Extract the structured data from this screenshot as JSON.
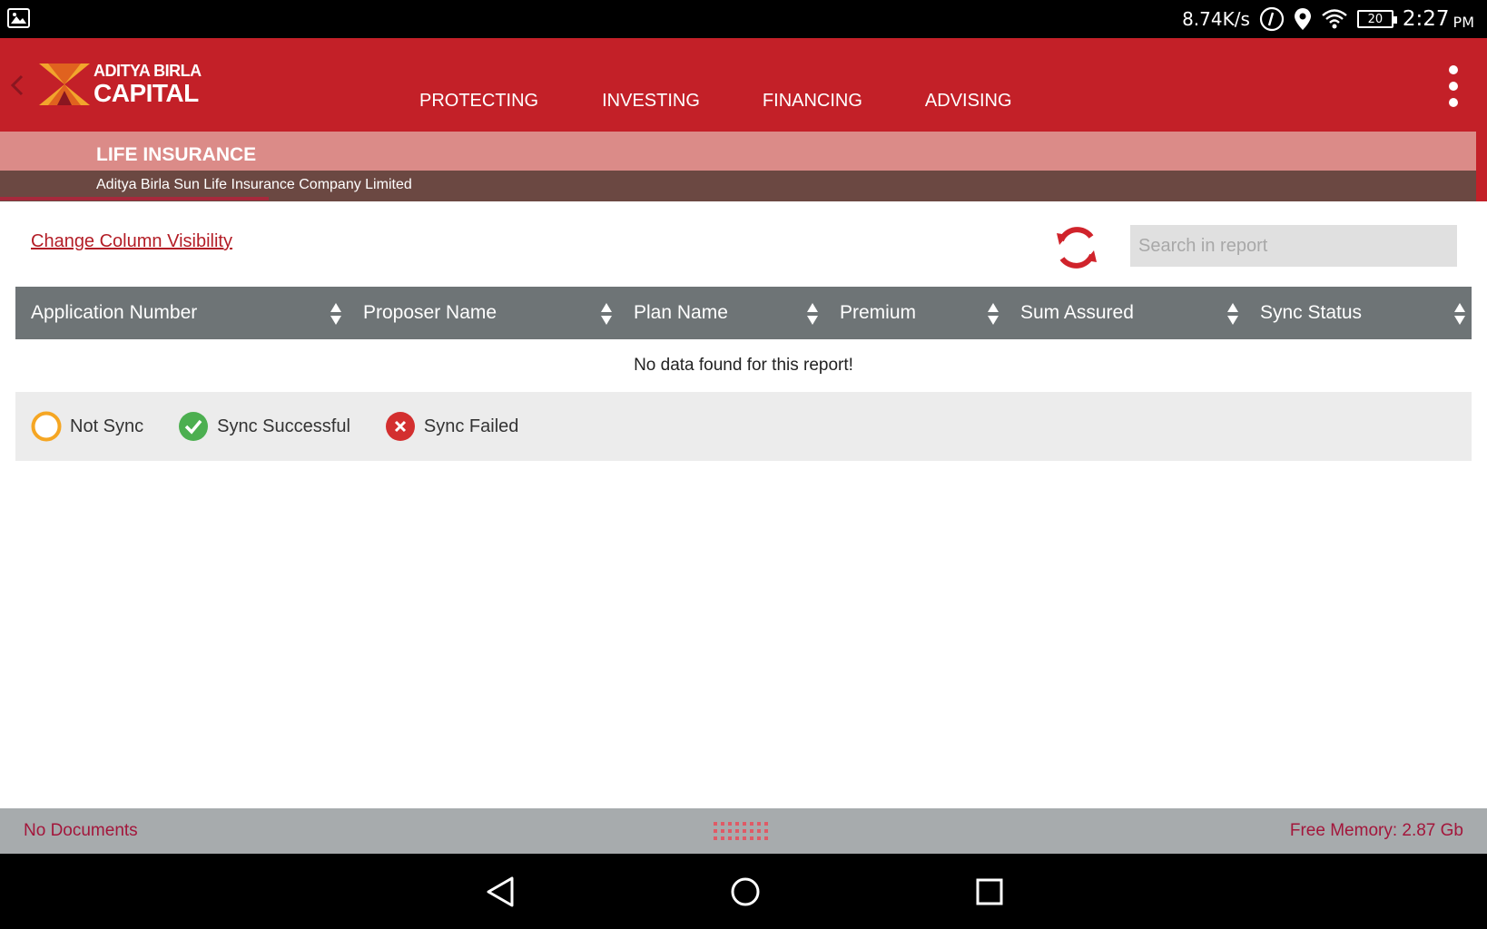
{
  "status_bar": {
    "net_speed": "8.74K/s",
    "battery": "20",
    "time": "2:27",
    "ampm": "PM",
    "icons": [
      "photo-icon",
      "data-saver-icon",
      "location-icon",
      "wifi-icon",
      "battery-icon"
    ]
  },
  "header": {
    "logo_line1": "ADITYA BIRLA",
    "logo_line2": "CAPITAL",
    "nav": [
      "PROTECTING",
      "INVESTING",
      "FINANCING",
      "ADVISING"
    ],
    "back_icon": "chevron-left-icon",
    "menu_icon": "kebab-menu-icon",
    "colors": {
      "brand_red": "#c32028",
      "banner_pink": "#db8b88",
      "banner_brown": "#6b4842"
    }
  },
  "banner": {
    "title": "LIFE INSURANCE",
    "subtitle": "Aditya Birla Sun Life Insurance Company Limited"
  },
  "toolbar": {
    "column_visibility_link": "Change Column Visibility",
    "search_placeholder": "Search in report",
    "search_value": "",
    "refresh_icon": "refresh-icon"
  },
  "table": {
    "columns": [
      "Application Number",
      "Proposer Name",
      "Plan Name",
      "Premium",
      "Sum Assured",
      "Sync Status"
    ],
    "empty_message": "No data found for this report!"
  },
  "legend": {
    "items": [
      {
        "label": "Not Sync",
        "icon": "empty-circle-icon",
        "color": "#f5a623"
      },
      {
        "label": "Sync Successful",
        "icon": "check-circle-icon",
        "color": "#4caf50"
      },
      {
        "label": "Sync Failed",
        "icon": "x-circle-icon",
        "color": "#d32f2f"
      }
    ]
  },
  "footer": {
    "left_text": "No Documents",
    "right_text": "Free Memory: 2.87 Gb",
    "grip_icon": "drag-handle-icon"
  },
  "android_nav": {
    "icons": [
      "back-triangle-icon",
      "home-circle-icon",
      "recents-square-icon"
    ]
  }
}
